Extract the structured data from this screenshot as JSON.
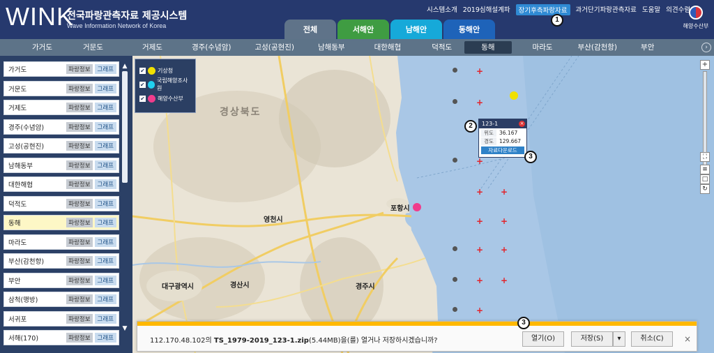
{
  "header": {
    "logo": "WINK",
    "title_kr": "전국파랑관측자료 제공시스템",
    "title_en": "Wave Information Network of Korea",
    "links": [
      "시스템소개",
      "2019심해설계파",
      "장기후측파랑자료",
      "과거단기파랑관측자료",
      "도움말",
      "의견수렴"
    ],
    "active_link": "장기후측파랑자료",
    "ministry": "해양수산부",
    "region_tabs": [
      "전체",
      "서해안",
      "남해안",
      "동해안"
    ]
  },
  "stations_bar": {
    "tabs": [
      "가거도",
      "거문도",
      "거제도",
      "경주(수념암)",
      "고성(공현진)",
      "남해동부",
      "대한해협",
      "덕적도",
      "동해",
      "마라도",
      "부산(감천항)",
      "부안"
    ],
    "selected": "동해"
  },
  "sidebar": {
    "info_label": "파랑정보",
    "graph_label": "그래프",
    "items": [
      "가거도",
      "거문도",
      "거제도",
      "경주(수념암)",
      "고성(공현진)",
      "남해동부",
      "대한해협",
      "덕적도",
      "동해",
      "마라도",
      "부산(감천항)",
      "부안",
      "삼척(맹방)",
      "서귀포",
      "서해(170)"
    ],
    "selected": "동해"
  },
  "map": {
    "legend": [
      {
        "label": "기상청",
        "color": "#f0e000"
      },
      {
        "label": "국립해양조사원",
        "color": "#20d0f0"
      },
      {
        "label": "해양수산부",
        "color": "#f03c8c"
      }
    ],
    "region_label": "경상북도",
    "cities": [
      "영천시",
      "포항시",
      "경주시",
      "대구광역시",
      "경산시"
    ],
    "popup": {
      "title": "123-1",
      "lat_label": "위도",
      "lat": "36.167",
      "lon_label": "경도",
      "lon": "129.667",
      "download_label": "자료다운로드"
    },
    "callouts": [
      "1",
      "2",
      "3",
      "3"
    ]
  },
  "download_bar": {
    "host": "112.170.48.102의 ",
    "file": "TS_1979-2019_123-1.zip",
    "size": "(5.44MB)을(를) 열거나 저장하시겠습니까?",
    "open": "열기(O)",
    "save": "저장(S)",
    "cancel": "취소(C)",
    "close": "×"
  }
}
